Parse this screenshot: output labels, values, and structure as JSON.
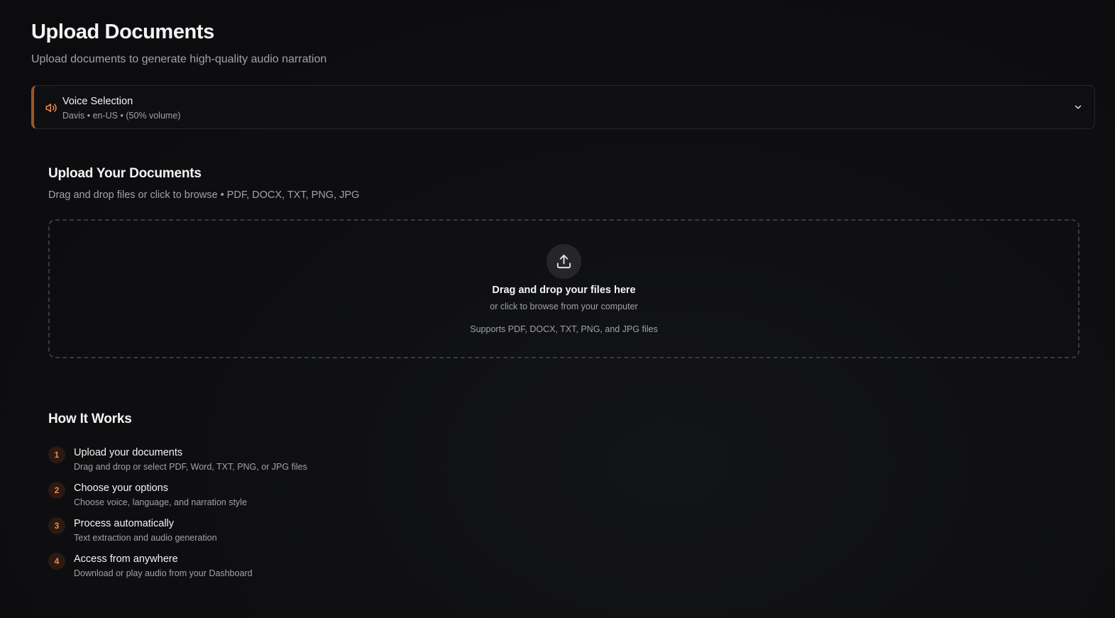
{
  "header": {
    "title": "Upload Documents",
    "subtitle": "Upload documents to generate high-quality audio narration"
  },
  "voice_selection": {
    "icon": "speaker-icon",
    "title": "Voice Selection",
    "detail": "Davis • en-US • (50% volume)",
    "accent_color": "#9a5527",
    "expand_icon": "chevron-down-icon"
  },
  "upload": {
    "heading": "Upload Your Documents",
    "description": "Drag and drop files or click to browse • PDF, DOCX, TXT, PNG, JPG",
    "dropzone": {
      "icon": "upload-icon",
      "title": "Drag and drop your files here",
      "subtitle": "or click to browse from your computer",
      "supported": "Supports PDF, DOCX, TXT, PNG, and JPG files"
    }
  },
  "how_it_works": {
    "heading": "How It Works",
    "accent_color": "#f08a4b",
    "steps": [
      {
        "number": "1",
        "title": "Upload your documents",
        "description": "Drag and drop or select PDF, Word, TXT, PNG, or JPG files"
      },
      {
        "number": "2",
        "title": "Choose your options",
        "description": "Choose voice, language, and narration style"
      },
      {
        "number": "3",
        "title": "Process automatically",
        "description": "Text extraction and audio generation"
      },
      {
        "number": "4",
        "title": "Access from anywhere",
        "description": "Download or play audio from your Dashboard"
      }
    ]
  }
}
